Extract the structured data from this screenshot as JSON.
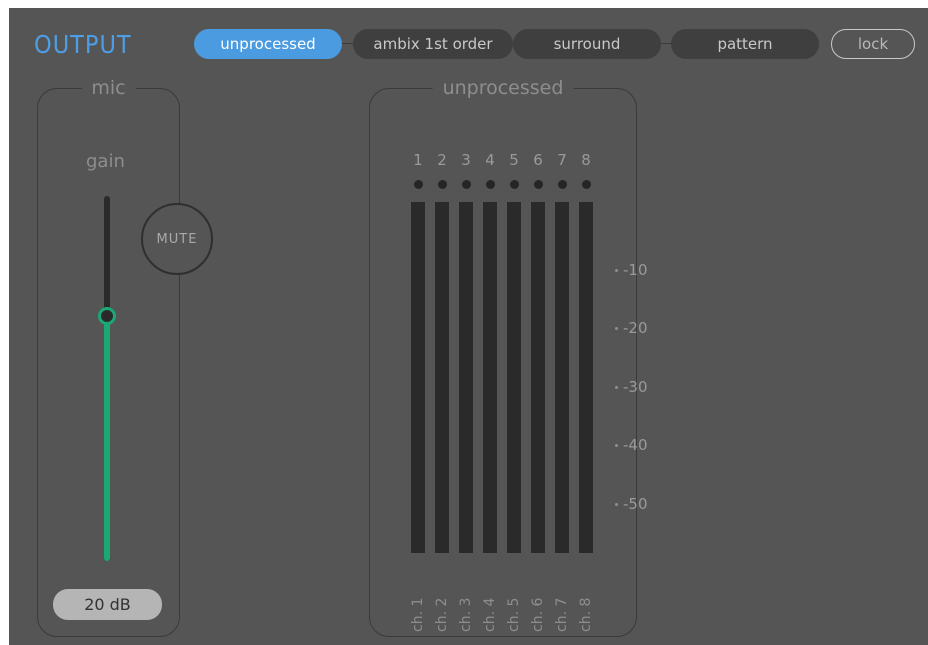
{
  "title": "OUTPUT",
  "tabs": [
    {
      "label": "unprocessed",
      "active": true
    },
    {
      "label": "ambix 1st order",
      "active": false
    },
    {
      "label": "surround",
      "active": false
    },
    {
      "label": "pattern",
      "active": false
    }
  ],
  "lock_label": "lock",
  "mic": {
    "group_label": "mic",
    "gain_label": "gain",
    "gain_value": "20 dB",
    "slider_level": 0.67,
    "mute_label": "MUTE"
  },
  "meters": {
    "group_label": "unprocessed",
    "channel_numbers": [
      "1",
      "2",
      "3",
      "4",
      "5",
      "6",
      "7",
      "8"
    ],
    "channel_labels": [
      "ch. 1",
      "ch. 2",
      "ch. 3",
      "ch. 4",
      "ch. 5",
      "ch. 6",
      "ch. 7",
      "ch. 8"
    ],
    "scale": [
      "-10",
      "-20",
      "-30",
      "-40",
      "-50"
    ]
  },
  "colors": {
    "accent": "#4c9ee6",
    "slider": "#1aa874",
    "background": "#555555"
  }
}
